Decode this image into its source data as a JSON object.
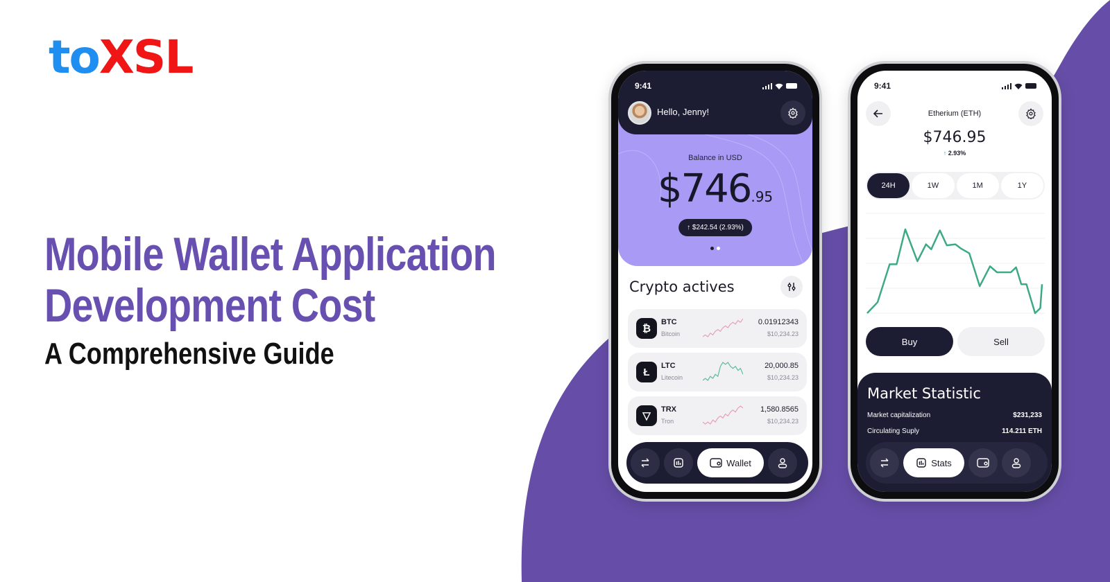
{
  "brand": {
    "logo_part1": "to",
    "logo_part2": "XSL",
    "colors": {
      "logo_blue": "#1e8ef0",
      "logo_red": "#f01616",
      "accent_purple": "#6750b0",
      "background_shape": "#664ea8"
    }
  },
  "headline": {
    "line1": "Mobile Wallet Application",
    "line2": "Development Cost",
    "subtitle": "A Comprehensive Guide"
  },
  "phone_wallet": {
    "status_time": "9:41",
    "greeting": "Hello, Jenny!",
    "avatar_icon": "user-avatar",
    "settings_icon": "gear-icon",
    "balance_label": "Balance in  USD",
    "balance_whole": "$746",
    "balance_cents": ".95",
    "change_label": "↑ $242.54 (2.93%)",
    "carousel_pages": 2,
    "carousel_active": 0,
    "section_title": "Crypto actives",
    "filter_icon": "sliders-icon",
    "coins": [
      {
        "symbol": "BTC",
        "name": "Bitcoin",
        "icon": "bitcoin-icon",
        "glyph": "₿",
        "amount": "0.01912343",
        "usd": "$10,234.23",
        "trend": "up",
        "spark_color": "#e8a0b4",
        "spark": [
          2,
          3,
          2,
          4,
          3,
          5,
          6,
          5,
          7,
          8,
          7,
          9,
          10,
          9,
          11,
          10,
          12
        ]
      },
      {
        "symbol": "LTC",
        "name": "Litecoin",
        "icon": "litecoin-icon",
        "glyph": "Ł",
        "amount": "20,000.85",
        "usd": "$10,234.23",
        "trend": "mixed",
        "spark_color": "#5bbd98",
        "spark": [
          3,
          4,
          3,
          5,
          4,
          6,
          5,
          10,
          12,
          11,
          12,
          10,
          9,
          10,
          8,
          9,
          6
        ]
      },
      {
        "symbol": "TRX",
        "name": "Tron",
        "icon": "tron-icon",
        "glyph": "▽",
        "amount": "1,580.8565",
        "usd": "$10,234.23",
        "trend": "up",
        "spark_color": "#e8a0b4",
        "spark": [
          3,
          2,
          3,
          2,
          4,
          3,
          5,
          6,
          5,
          7,
          6,
          8,
          9,
          8,
          10,
          11,
          10
        ]
      }
    ],
    "tabbar": [
      {
        "name": "transfer",
        "icon": "swap-arrows-icon",
        "label": ""
      },
      {
        "name": "stats",
        "icon": "bar-chart-icon",
        "label": ""
      },
      {
        "name": "wallet",
        "icon": "wallet-icon",
        "label": "Wallet",
        "active": true
      },
      {
        "name": "profile",
        "icon": "user-icon",
        "label": ""
      }
    ]
  },
  "phone_coin": {
    "status_time": "9:41",
    "back_icon": "arrow-left-icon",
    "settings_icon": "gear-icon",
    "title": "Etherium (ETH)",
    "price": "$746.95",
    "change_arrow": "↑",
    "change": "2.93%",
    "ranges": [
      {
        "label": "24H",
        "active": true
      },
      {
        "label": "1W",
        "active": false
      },
      {
        "label": "1M",
        "active": false
      },
      {
        "label": "1Y",
        "active": false
      }
    ],
    "buy_label": "Buy",
    "sell_label": "Sell",
    "market_title": "Market Statistic",
    "stats": [
      {
        "label": "Market capitalization",
        "value": "$231,233"
      },
      {
        "label": "Circulating Suply",
        "value": "114.211 ETH"
      }
    ],
    "tabbar": [
      {
        "name": "transfer",
        "icon": "swap-arrows-icon",
        "label": ""
      },
      {
        "name": "stats",
        "icon": "bar-chart-icon",
        "label": "Stats",
        "active": true
      },
      {
        "name": "wallet",
        "icon": "wallet-icon",
        "label": ""
      },
      {
        "name": "profile",
        "icon": "user-icon",
        "label": ""
      }
    ]
  },
  "chart_data": {
    "type": "line",
    "title": "Etherium (ETH) 24H",
    "xlabel": "",
    "ylabel": "",
    "grid": true,
    "ylim": [
      0,
      100
    ],
    "series": [
      {
        "name": "ETH price (relative)",
        "color": "#3daa84",
        "x": [
          0,
          6,
          13,
          17,
          22,
          29,
          34,
          37,
          42,
          46,
          51,
          54,
          59,
          65,
          71,
          75,
          83,
          86,
          89,
          92,
          97,
          100,
          101
        ],
        "values": [
          0,
          11,
          49,
          49,
          84,
          52,
          69,
          64,
          83,
          68,
          69,
          65,
          60,
          27,
          47,
          41,
          41,
          46,
          29,
          29,
          0,
          5,
          29
        ]
      }
    ]
  }
}
